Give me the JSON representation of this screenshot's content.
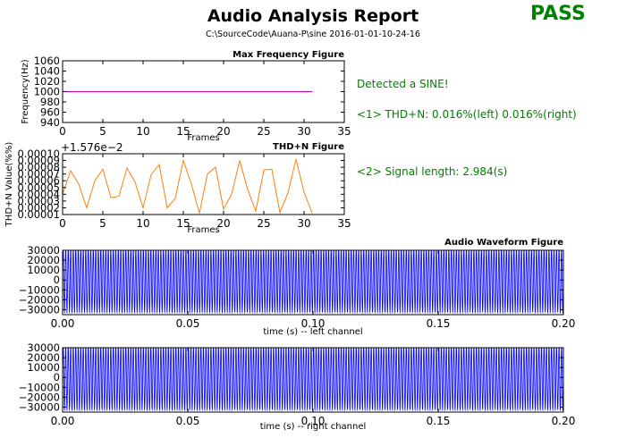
{
  "report": {
    "title": "Audio Analysis Report",
    "subtitle": "C:\\SourceCode\\Auana-P\\sine  2016-01-01-10-24-16",
    "verdict": "PASS",
    "verdict_color": "#008000",
    "info_color": "#008000",
    "info": {
      "detected": "Detected a SINE!",
      "thdn": "<1> THD+N: 0.016%(left)   0.016%(right)",
      "length": "<2> Signal length: 2.984(s)"
    }
  },
  "chart_data": [
    {
      "type": "line",
      "title": "Max Frequency Figure",
      "xlabel": "Frames",
      "ylabel": "Frequency(Hz)",
      "xlim": [
        0,
        35
      ],
      "ylim": [
        940,
        1060
      ],
      "xticks": [
        "0",
        "5",
        "10",
        "15",
        "20",
        "25",
        "30",
        "35"
      ],
      "yticks": [
        "940",
        "960",
        "980",
        "1000",
        "1020",
        "1040",
        "1060"
      ],
      "grid": false,
      "series": [
        {
          "color": "#bf00bf",
          "x": [
            0,
            31
          ],
          "y": [
            1000,
            1000
          ]
        }
      ]
    },
    {
      "type": "line",
      "title": "THD+N Figure",
      "xlabel": "Frames",
      "ylabel": "THD+N Value(%%)",
      "offset_label": "+1.576e−2",
      "xlim": [
        0,
        35
      ],
      "ylim": [
        1e-05,
        0.0001
      ],
      "xticks": [
        "0",
        "5",
        "10",
        "15",
        "20",
        "25",
        "30",
        "35"
      ],
      "yticks": [
        "0.00001",
        "0.00002",
        "0.00003",
        "0.00004",
        "0.00005",
        "0.00006",
        "0.00007",
        "0.00008",
        "0.00009",
        "0.00010"
      ],
      "grid": false,
      "series": [
        {
          "color": "#ff7f0e",
          "x": [
            0,
            1,
            2,
            3,
            4,
            5,
            6,
            7,
            8,
            9,
            10,
            11,
            12,
            13,
            14,
            15,
            16,
            17,
            18,
            19,
            20,
            21,
            22,
            23,
            24,
            25,
            26,
            27,
            28,
            29,
            30,
            31
          ],
          "y": [
            4e-05,
            7.5e-05,
            5.5e-05,
            2e-05,
            6e-05,
            7.7e-05,
            3.5e-05,
            3.7e-05,
            7.9e-05,
            5.8e-05,
            2e-05,
            6.9e-05,
            8.4e-05,
            2e-05,
            3.4e-05,
            9e-05,
            5.5e-05,
            1.2e-05,
            7e-05,
            8e-05,
            1.8e-05,
            4e-05,
            9e-05,
            4.7e-05,
            1.5e-05,
            7.6e-05,
            7.7e-05,
            1.3e-05,
            4.2e-05,
            9.2e-05,
            4.3e-05,
            1.2e-05
          ]
        }
      ]
    },
    {
      "type": "line",
      "title": "Audio Waveform Figure",
      "xlabel": "time (s) -- left channel",
      "ylabel": "",
      "xlim": [
        0,
        0.2
      ],
      "ylim": [
        -35000,
        30000
      ],
      "xticks": [
        "0.00",
        "0.05",
        "0.10",
        "0.15",
        "0.20"
      ],
      "yticks": [
        "−30000",
        "−20000",
        "−10000",
        "0",
        "10000",
        "20000",
        "30000"
      ],
      "grid": false,
      "series": [
        {
          "color": "#0000ff",
          "waveform": "sine",
          "frequency_hz": 1000,
          "amplitude": 32767
        }
      ]
    },
    {
      "type": "line",
      "title": "",
      "xlabel": "time (s) -- right channel",
      "ylabel": "",
      "xlim": [
        0,
        0.2
      ],
      "ylim": [
        -35000,
        30000
      ],
      "xticks": [
        "0.00",
        "0.05",
        "0.10",
        "0.15",
        "0.20"
      ],
      "yticks": [
        "−30000",
        "−20000",
        "−10000",
        "0",
        "10000",
        "20000",
        "30000"
      ],
      "grid": false,
      "series": [
        {
          "color": "#0000ff",
          "waveform": "sine",
          "frequency_hz": 1000,
          "amplitude": 32767
        }
      ]
    }
  ]
}
